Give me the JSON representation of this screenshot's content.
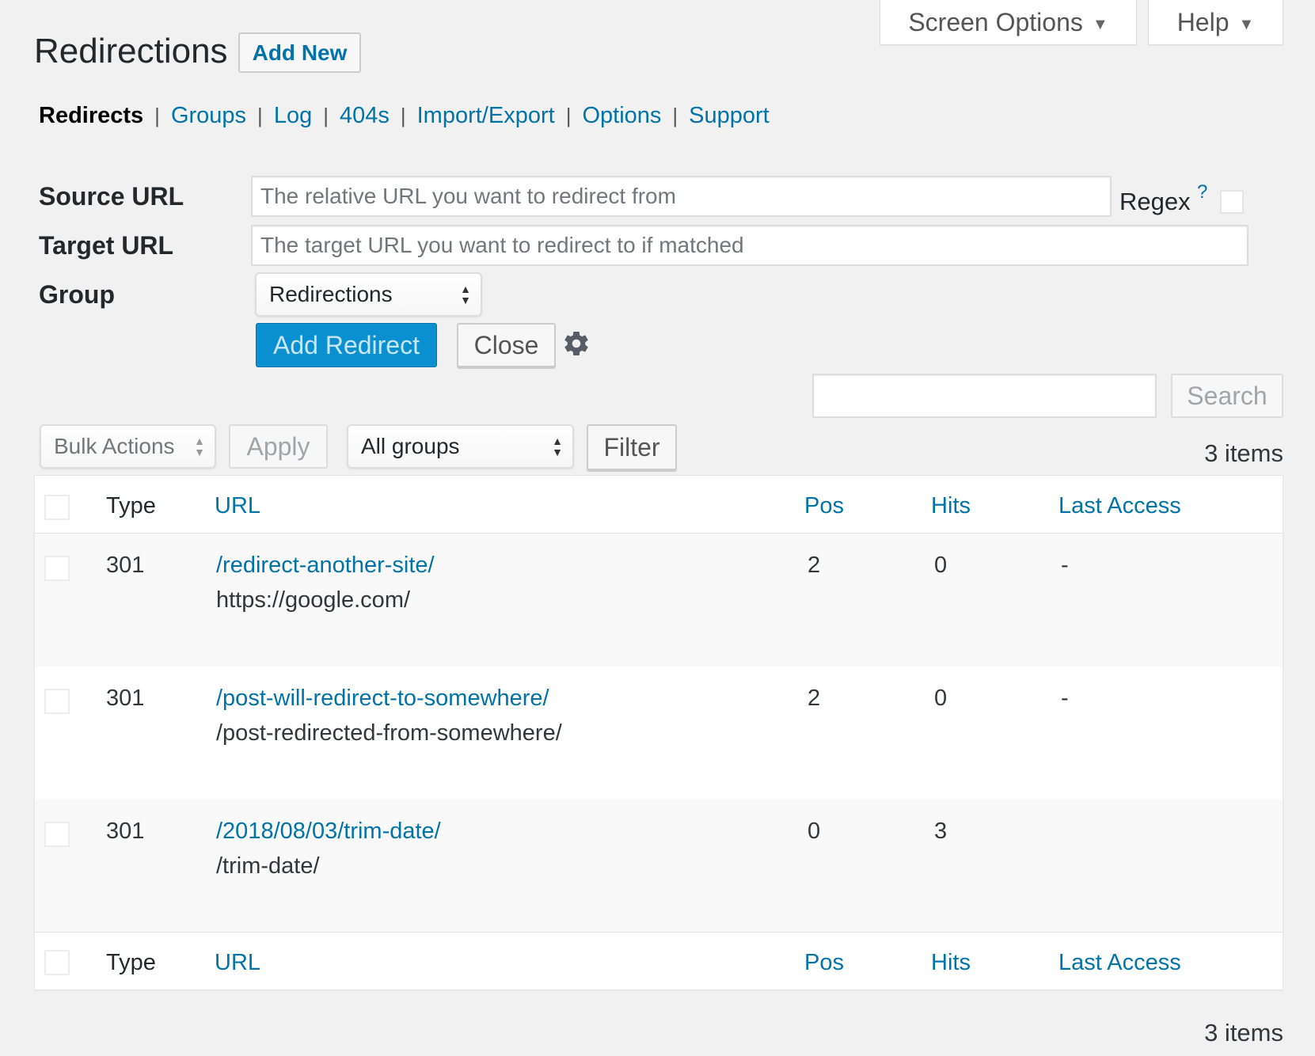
{
  "header": {
    "title": "Redirections",
    "add_new": "Add New",
    "screen_options": "Screen Options",
    "help": "Help"
  },
  "nav": {
    "items": [
      "Redirects",
      "Groups",
      "Log",
      "404s",
      "Import/Export",
      "Options",
      "Support"
    ],
    "separator": "|"
  },
  "form": {
    "source_label": "Source URL",
    "source_placeholder": "The relative URL you want to redirect from",
    "target_label": "Target URL",
    "target_placeholder": "The target URL you want to redirect to if matched",
    "group_label": "Group",
    "group_value": "Redirections",
    "regex_label": "Regex",
    "regex_help": "?",
    "add_button": "Add Redirect",
    "close_button": "Close"
  },
  "search": {
    "button": "Search"
  },
  "tablenav": {
    "bulk_actions": "Bulk Actions",
    "apply": "Apply",
    "group_filter": "All groups",
    "filter": "Filter",
    "items_count": "3 items"
  },
  "table": {
    "columns": {
      "type": "Type",
      "url": "URL",
      "pos": "Pos",
      "hits": "Hits",
      "last_access": "Last Access"
    },
    "rows": [
      {
        "type": "301",
        "url": "/redirect-another-site/",
        "target": "https://google.com/",
        "pos": "2",
        "hits": "0",
        "last_access": "-"
      },
      {
        "type": "301",
        "url": "/post-will-redirect-to-somewhere/",
        "target": "/post-redirected-from-somewhere/",
        "pos": "2",
        "hits": "0",
        "last_access": "-"
      },
      {
        "type": "301",
        "url": "/2018/08/03/trim-date/",
        "target": "/trim-date/",
        "pos": "0",
        "hits": "3",
        "last_access": ""
      }
    ]
  },
  "colors": {
    "link": "#0073aa",
    "primary_button": "#0a8fd0",
    "background": "#f1f1f1"
  },
  "icons": {
    "gear": "gear-icon",
    "caret": "caret-down-icon"
  }
}
